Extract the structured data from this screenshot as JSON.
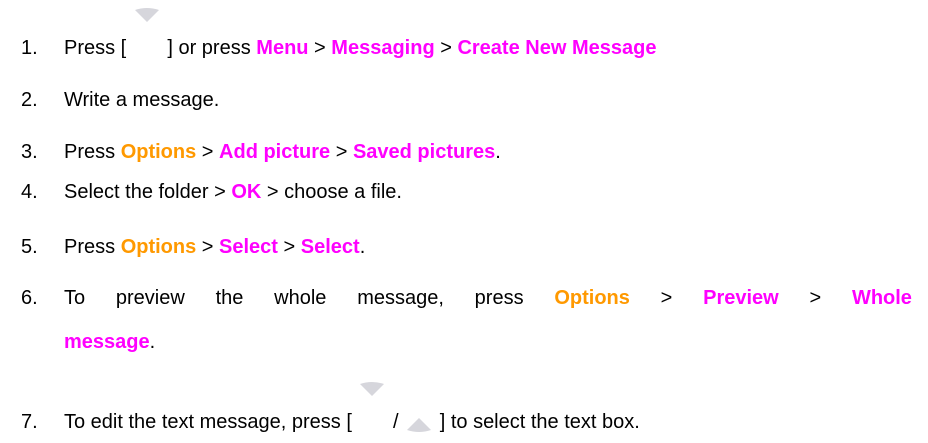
{
  "colors": {
    "highlight_orange": "#ff9900",
    "highlight_magenta": "#ff00ff",
    "key_grey": "#c8c8d0"
  },
  "steps": [
    {
      "number": "1.",
      "parts": [
        {
          "text": "Press [ ",
          "style": "plain"
        },
        {
          "icon": "nav-up-key-icon"
        },
        {
          "text": " ] or press ",
          "style": "plain"
        },
        {
          "text": "Menu",
          "style": "magenta"
        },
        {
          "text": " > ",
          "style": "plain"
        },
        {
          "text": "Messaging",
          "style": "magenta"
        },
        {
          "text": " > ",
          "style": "plain"
        },
        {
          "text": "Create New Message",
          "style": "magenta"
        }
      ]
    },
    {
      "number": "2.",
      "parts": [
        {
          "text": "Write a message.",
          "style": "plain"
        }
      ]
    },
    {
      "number": "3.",
      "parts": [
        {
          "text": "Press ",
          "style": "plain"
        },
        {
          "text": "Options",
          "style": "orange"
        },
        {
          "text": " > ",
          "style": "plain"
        },
        {
          "text": "Add picture",
          "style": "magenta"
        },
        {
          "text": " > ",
          "style": "plain"
        },
        {
          "text": "Saved pictures",
          "style": "magenta"
        },
        {
          "text": ".",
          "style": "plain"
        }
      ]
    },
    {
      "number": "4.",
      "parts": [
        {
          "text": "Select the folder > ",
          "style": "plain"
        },
        {
          "text": "OK",
          "style": "magenta"
        },
        {
          "text": " > choose a file.",
          "style": "plain"
        }
      ]
    },
    {
      "number": "5.",
      "parts": [
        {
          "text": "Press ",
          "style": "plain"
        },
        {
          "text": "Options",
          "style": "orange"
        },
        {
          "text": " > ",
          "style": "plain"
        },
        {
          "text": "Select",
          "style": "magenta"
        },
        {
          "text": " > ",
          "style": "plain"
        },
        {
          "text": "Select",
          "style": "magenta"
        },
        {
          "text": ".",
          "style": "plain"
        }
      ]
    },
    {
      "number": "6.",
      "parts": [
        {
          "text": "To preview the whole message, press ",
          "style": "plain"
        },
        {
          "text": "Options",
          "style": "orange"
        },
        {
          "text": " > ",
          "style": "plain"
        },
        {
          "text": "Preview",
          "style": "magenta"
        },
        {
          "text": " > ",
          "style": "plain"
        },
        {
          "text": "Whole",
          "style": "magenta"
        }
      ],
      "continuation": [
        {
          "text": "message",
          "style": "magenta"
        },
        {
          "text": ".",
          "style": "plain"
        }
      ]
    },
    {
      "number": "7.",
      "parts": [
        {
          "text": "To edit the text message, press [ ",
          "style": "plain"
        },
        {
          "icon": "nav-up-key-icon"
        },
        {
          "text": " / ",
          "style": "plain"
        },
        {
          "icon": "nav-down-key-icon"
        },
        {
          "text": " ] to select the text box.",
          "style": "plain"
        }
      ]
    }
  ]
}
